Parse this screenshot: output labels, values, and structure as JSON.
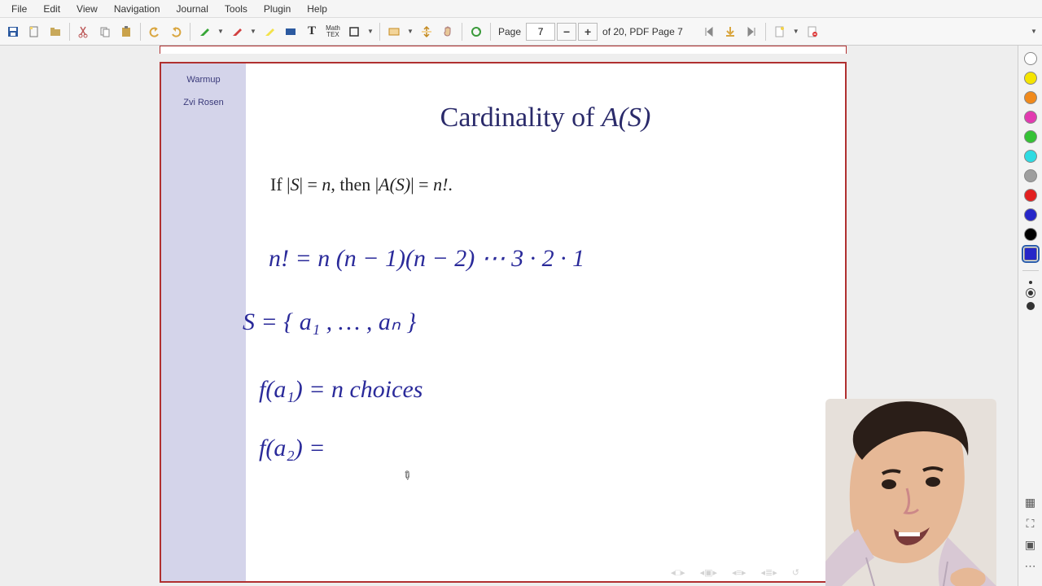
{
  "menubar": [
    "File",
    "Edit",
    "View",
    "Navigation",
    "Journal",
    "Tools",
    "Plugin",
    "Help"
  ],
  "toolbar": {
    "page_label": "Page",
    "page_value": "7",
    "page_total": "of 20, PDF Page 7"
  },
  "slide": {
    "sidebar": {
      "warmup": "Warmup",
      "author": "Zvi Rosen"
    },
    "title_plain": "Cardinality of ",
    "title_math": "A(S)",
    "body_prefix": "If |",
    "body_s": "S",
    "body_mid": "| = ",
    "body_n": "n",
    "body_then": ", then |",
    "body_as": "A(S)",
    "body_eq": "| = ",
    "body_nfact": "n!",
    "body_dot": "."
  },
  "handwriting": {
    "line1": "n!  =  n (n − 1)(n − 2) ⋯ 3 · 2 · 1",
    "line2": "S  =  { a₁ , … ,  aₙ }",
    "line3": "f(a₁)   =   n   choices",
    "line4": "f(a₂)   ="
  },
  "palette_colors": [
    "#ffffff",
    "#f5e400",
    "#f08a1c",
    "#e23ab0",
    "#35c235",
    "#2edbe2",
    "#9e9e9e",
    "#e22020",
    "#2626c8",
    "#000000"
  ],
  "palette_selected_index": 8,
  "navdots": [
    "◂□▸",
    "◂▣▸",
    "◂≡▸",
    "◂≣▸",
    "↺"
  ]
}
